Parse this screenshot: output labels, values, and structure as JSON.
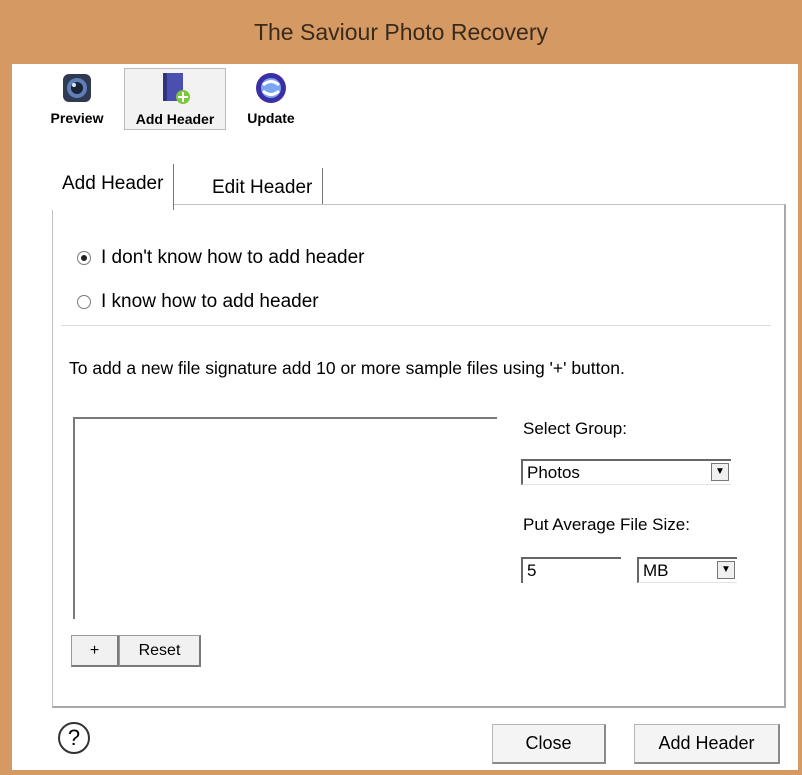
{
  "window": {
    "title": "The Saviour Photo Recovery"
  },
  "toolbar": {
    "preview_label": "Preview",
    "add_header_label": "Add Header",
    "update_label": "Update"
  },
  "tabs": [
    {
      "label": "Add Header",
      "active": true
    },
    {
      "label": "Edit Header",
      "active": false
    }
  ],
  "options": {
    "dont_know": "I don't know how to add header",
    "know": "I know how to add header"
  },
  "info_text": "To add a new file signature add 10 or more sample files using '+' button.",
  "group": {
    "label": "Select Group:",
    "value": "Photos"
  },
  "size": {
    "label": "Put Average File Size:",
    "value": "5",
    "unit": "MB"
  },
  "list_buttons": {
    "add": "+",
    "reset": "Reset"
  },
  "footer": {
    "help": "?",
    "close": "Close",
    "add_header": "Add Header"
  },
  "colors": {
    "title_bar": "#d59a63",
    "panel_border": "#c2c2c2"
  },
  "icons": {
    "preview": "camera-lens-icon",
    "add_header": "book-add-icon",
    "update": "globe-refresh-icon"
  }
}
